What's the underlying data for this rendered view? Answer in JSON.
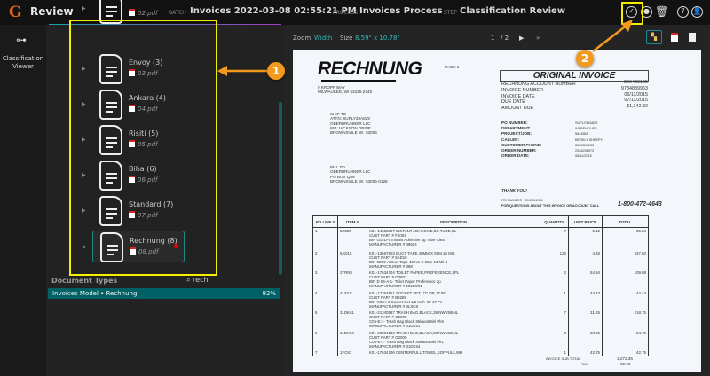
{
  "header": {
    "logo": "G",
    "title": "Review",
    "batch_label": "BATCH",
    "batch": "Invoices 2022-03-08 02:55:21 PM",
    "process_label": "PROCESS",
    "process": "Invoices Process",
    "step_label": "STEP",
    "step": "Classification Review",
    "sep": "•"
  },
  "rail": {
    "label": "Classification Viewer"
  },
  "documents": [
    {
      "name": "",
      "file": "02.pdf"
    },
    {
      "name": "Envoy (3)",
      "file": "03.pdf"
    },
    {
      "name": "Ankara (4)",
      "file": "04.pdf"
    },
    {
      "name": "Risiti (5)",
      "file": "05.pdf"
    },
    {
      "name": "Biha (6)",
      "file": "06.pdf"
    },
    {
      "name": "Standard (7)",
      "file": "07.pdf"
    },
    {
      "name": "Rechnung (8)",
      "file": "08.pdf"
    }
  ],
  "doc_types": {
    "label": "Document Types",
    "search": "rech",
    "rows": [
      {
        "name": "Invoices Model • Rechnung",
        "score": "92%"
      }
    ]
  },
  "viewer": {
    "zoom_label": "Zoom",
    "zoom_value": "Width",
    "size_label": "Size",
    "size_value": "8.59\" x 10.78\"",
    "page": "1",
    "pages": "/ 2"
  },
  "annotations": {
    "one": "1",
    "two": "2"
  },
  "colors": {
    "accent": "#006064",
    "annotation": "#f39a1e",
    "highlight": "#f5ee00"
  },
  "invoice": {
    "title": "RECHNUNG",
    "page": "PAGE 1",
    "address": "9 KROPF WAY\nMILWAUKEE, WI 53225-2245",
    "ship_to": "SHIP TO\nATTN: SUPLY39A829\nOBERBRUNNER LLC\n854 JACKSON DRIVE\nBROWNSVILE WI  53006",
    "bill_to": "BILL TO\nOBERBRUNNER LLC\nPO BOX Q49\nBROWNSVILE WI  53006-0128",
    "original": "ORIGINAL INVOICE",
    "summary_labels": "RECHNUNG ACCOUNT NUMBER\nINVOICE NUMBER\nINVOICE DATE\nDUE DATE\nAMOUNT DUE",
    "summary_values": "806439105\n9784889953\n06/11/2015\n07/11/2015\n$1,342.32",
    "detail_labels": "PO NUMBER:\nDEPARTMENT:\nPROJECT/JOB:\nCALLER:\nCUSTOMER PHONE:\nORDER NUMBER:\nORDER DATE:",
    "detail_values": "SUPLY39A829\nWAREHOUSE\n5644855\nBERKLY SHEEPY\n5555554233\n2348236973\n06/11/2015",
    "thanks": "THANK YOU!",
    "fei": "FEI NUMBER   39-2261391",
    "questions": "FOR QUESTIONS ABOUT THIS INVOICE OR ACCOUNT CALL",
    "phone": "1-800-472-4643",
    "columns": [
      "PO LINE #",
      "ITEM #",
      "DESCRIPTION",
      "QUANTITY",
      "UNIT PRICE",
      "TOTAL"
    ],
    "rows": [
      {
        "line": "1",
        "item": "5E355",
        "desc": "K01-14525207 INSTANT ADHESIVE,3G TUBE,CL\nCUST PART # F1004\nBIN G02D-5 Instant Adhesive 3g Tube Clea\nMANUFACTURER # 49504",
        "qty": "7",
        "unit": "5.12",
        "total": "35.84"
      },
      {
        "line": "2",
        "item": "5AD15",
        "desc": "K01-13667803 DUCT TAPE,48MM X 55M,10 MIL\nCUST PART # 5AD15\nBIN 5E55-A Duct Tape 48mm X 55m 10 Mil S\nMANUFACTURER # 398",
        "qty": "120",
        "unit": "4.48",
        "total": "537.60"
      },
      {
        "line": "3",
        "item": "2TRN8",
        "desc": "K01-17634704 TOILET PAPER,PREFERENCE,2PL\nCUST PART # G3802\nBIN D 54-A-1- Toilet Paper Preference 2p\nMANUFACTURER # 18280/01",
        "qty": "2",
        "unit": "54.94",
        "total": "109.88"
      },
      {
        "line": "4",
        "item": "4LXC8",
        "desc": "K01-17354851 SOCKET SET,1/2\" DR,17 PC\nCUST PART # B8289\nBIN K03H-2 Socket Set 1/2 Inch  Dr 17 Pc\nMANUFACTURER # 4LXC8",
        "qty": "1",
        "unit": "44.43",
        "total": "44.43"
      },
      {
        "line": "5",
        "item": "31DK61",
        "desc": "K01-21340987 TRASH BAG,BLACK,36INWX58INL\nCUST PART # G2002\nC05-E-1- Trash Bag Black 36inwx58inl Pk5\nMANUFACTURER # 31DK61",
        "qty": "7",
        "unit": "31.25",
        "total": "218.75"
      },
      {
        "line": "6",
        "item": "31DK54",
        "desc": "K01-20894136 TRASH BAG,BLACK,30INWX36INL\nCUST PART # G2000\nC05-E-1- Trash Bag Black 30inwx36inl Pk1\nMANUFACTURER # 31DK54",
        "qty": "3",
        "unit": "28.25",
        "total": "84.75"
      },
      {
        "line": "7",
        "item": "1FC87",
        "desc": "K01-17634706 CENTERPULL TOWEL,SOFPULL,WH",
        "qty": "1",
        "unit": "42.75",
        "total": "42.75"
      }
    ],
    "subtotal_label": "INVOICE SUB TOTAL",
    "subtotal": "1,272.36",
    "tax_label": "TAX",
    "tax": "69.96"
  }
}
